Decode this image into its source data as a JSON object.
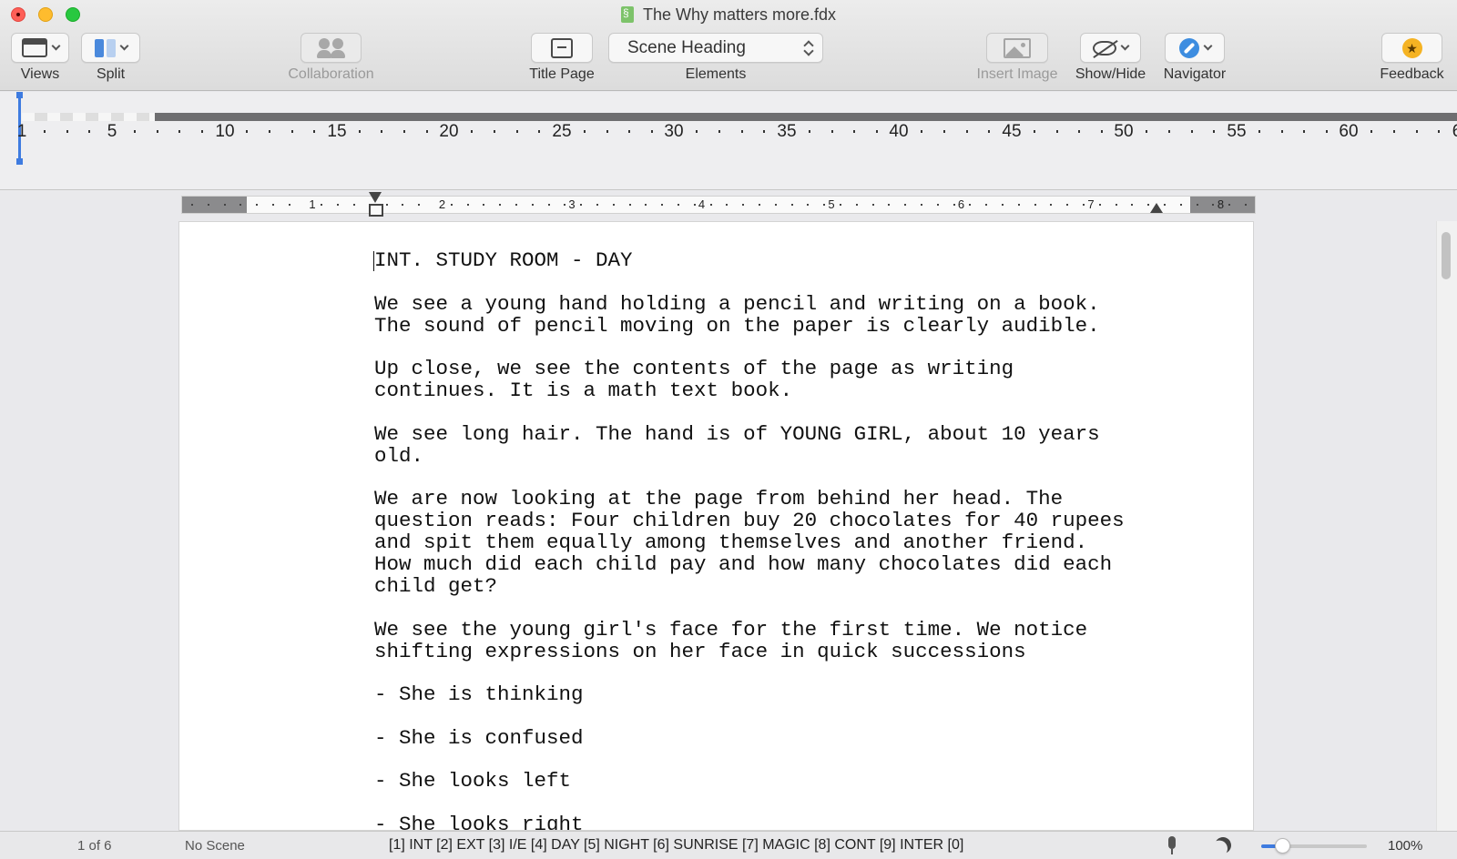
{
  "window": {
    "title": "The Why matters more.fdx"
  },
  "toolbar": {
    "views_label": "Views",
    "split_label": "Split",
    "collaboration_label": "Collaboration",
    "title_page_label": "Title Page",
    "elements_value": "Scene Heading",
    "elements_label": "Elements",
    "insert_image_label": "Insert Image",
    "show_hide_label": "Show/Hide",
    "navigator_label": "Navigator",
    "feedback_label": "Feedback"
  },
  "column_ruler": {
    "labels": [
      "1",
      "5",
      "10",
      "15",
      "20",
      "25",
      "30",
      "35",
      "40",
      "45",
      "50",
      "55",
      "60",
      "6"
    ]
  },
  "page_ruler": {
    "labels": [
      "1",
      "2",
      "3",
      "4",
      "5",
      "6",
      "7",
      "8"
    ]
  },
  "script": {
    "paragraphs": [
      "INT. STUDY ROOM - DAY",
      "We see a young hand holding a pencil and writing on a book.\nThe sound of pencil moving on the paper is clearly audible.",
      "Up close, we see the contents of the page as writing\ncontinues. It is a math text book.",
      "We see long hair. The hand is of YOUNG GIRL, about 10 years\nold.",
      "We are now looking at the page from behind her head. The\nquestion reads: Four children buy 20 chocolates for 40 rupees\nand spit them equally among themselves and another friend.\nHow much did each child pay and how many chocolates did each\nchild get?",
      "We see the young girl's face for the first time. We notice\nshifting expressions on her face in quick successions",
      "- She is thinking",
      "- She is confused",
      "- She looks left",
      "- She looks right"
    ]
  },
  "status": {
    "page": "1 of 6",
    "scene": "No Scene",
    "shortcuts": "[1] INT [2] EXT [3] I/E [4] DAY [5] NIGHT [6] SUNRISE [7] MAGIC [8] CONT [9] INTER [0]",
    "zoom": "100%",
    "zoom_level": 0.2
  },
  "colors": {
    "accent": "#3e7be0",
    "close": "#fe5f57",
    "minimize": "#febc2e",
    "maximize": "#28c840"
  }
}
